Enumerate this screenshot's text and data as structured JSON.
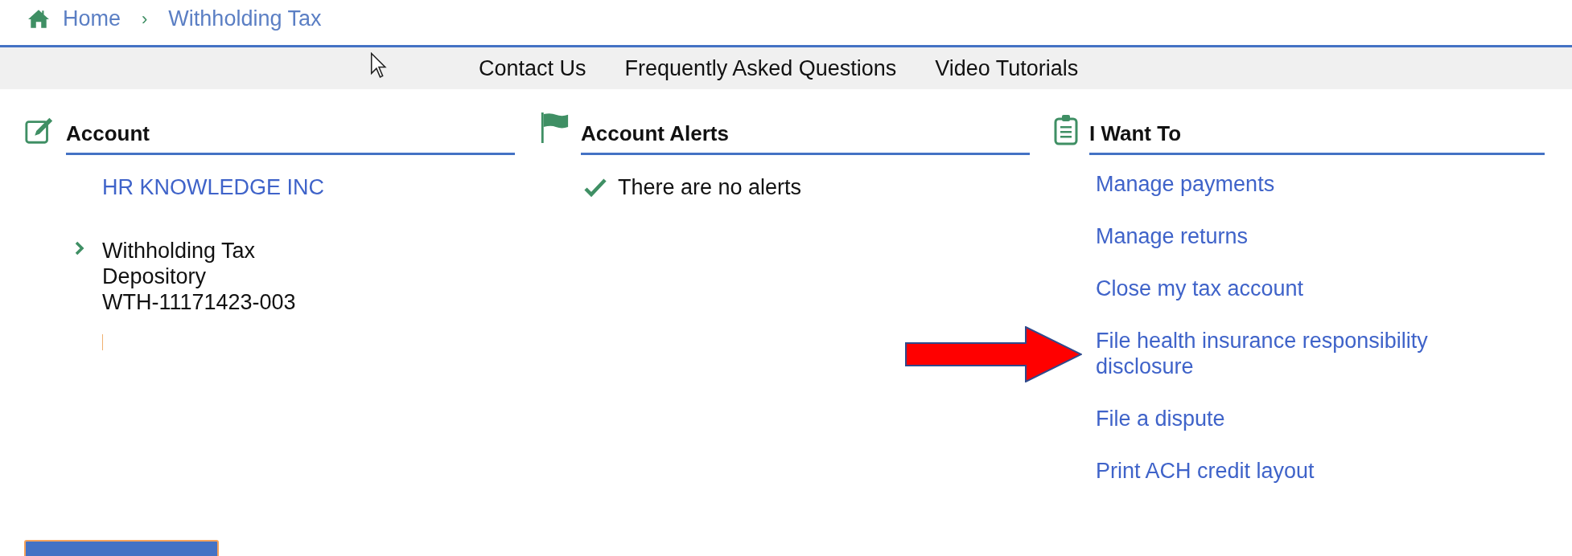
{
  "breadcrumb": [
    {
      "label": "Home",
      "kind": "home"
    },
    {
      "label": "Withholding Tax",
      "kind": "page"
    }
  ],
  "separator": "›",
  "nav": [
    "Contact Us",
    "Frequently Asked Questions",
    "Video Tutorials"
  ],
  "sections": [
    {
      "kind": "account",
      "title": "Account",
      "name": "HR KNOWLEDGE INC",
      "accounts": [
        {
          "lines": [
            "Withholding Tax",
            "Depository",
            "WTH-11171423-003"
          ]
        }
      ]
    },
    {
      "kind": "alerts",
      "title": "Account Alerts",
      "message": "There are no alerts"
    },
    {
      "kind": "actions",
      "title": "I Want To",
      "links": [
        {
          "label": "Manage payments",
          "highlighted": false
        },
        {
          "label": "Manage returns",
          "highlighted": false
        },
        {
          "label": "Close my tax account",
          "highlighted": false
        },
        {
          "label": "File health insurance responsibility disclosure",
          "highlighted": true
        },
        {
          "label": "File a dispute",
          "highlighted": false
        },
        {
          "label": "Print ACH credit layout",
          "highlighted": false
        }
      ]
    }
  ]
}
